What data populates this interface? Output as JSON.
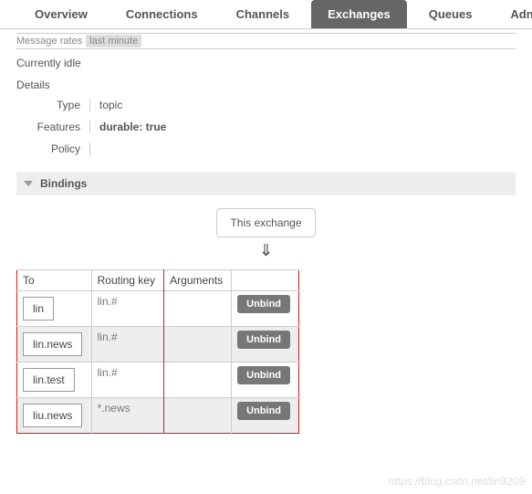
{
  "tabs": {
    "overview": "Overview",
    "connections": "Connections",
    "channels": "Channels",
    "exchanges": "Exchanges",
    "queues": "Queues",
    "admin": "Adn"
  },
  "rates": {
    "label": "Message rates",
    "chip": "last minute"
  },
  "idle_text": "Currently idle",
  "details": {
    "header": "Details",
    "type_label": "Type",
    "type_value": "topic",
    "features_label": "Features",
    "features_value": "durable: true",
    "policy_label": "Policy",
    "policy_value": ""
  },
  "bindings": {
    "header": "Bindings",
    "this_exchange": "This exchange",
    "arrow": "⇓",
    "columns": {
      "to": "To",
      "routing_key": "Routing key",
      "arguments": "Arguments"
    },
    "unbind_label": "Unbind",
    "rows": [
      {
        "to": "lin",
        "routing_key": "lin.#",
        "arguments": ""
      },
      {
        "to": "lin.news",
        "routing_key": "lin.#",
        "arguments": ""
      },
      {
        "to": "lin.test",
        "routing_key": "lin.#",
        "arguments": ""
      },
      {
        "to": "liu.news",
        "routing_key": "*.news",
        "arguments": ""
      }
    ]
  },
  "watermark": "https://blog.csdn.net/lin9209"
}
